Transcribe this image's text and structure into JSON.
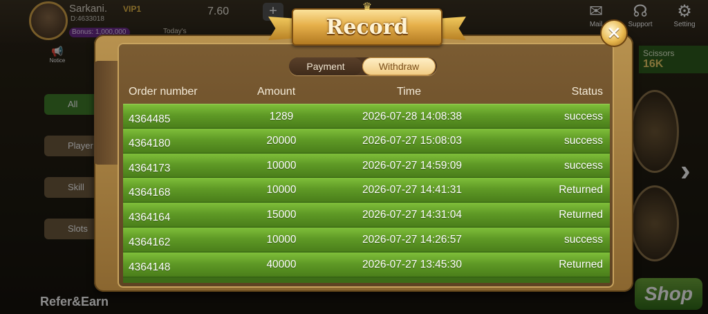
{
  "background": {
    "user_name": "Sarkani.",
    "user_id": "D:4633018",
    "bonus": "Bonus: 1,000,000",
    "vip": "VIP1",
    "balance": "7.60",
    "today_label": "Today's",
    "notice_label": "Notice",
    "top_icons": [
      {
        "name": "mail-icon",
        "label": "Mail",
        "glyph": "✉"
      },
      {
        "name": "support-icon",
        "label": "Support",
        "glyph": "☊"
      },
      {
        "name": "setting-icon",
        "label": "Setting",
        "glyph": "⚙"
      }
    ],
    "side_buttons": [
      "All",
      "Player",
      "Skill",
      "Slots"
    ],
    "right_game": {
      "label": "Scissors",
      "value": "16K"
    },
    "shop_label": "Shop",
    "refer_label": "Refer&Earn"
  },
  "modal": {
    "title": "Record",
    "close_glyph": "✕",
    "tabs": [
      {
        "label": "Payment",
        "active": false
      },
      {
        "label": "Withdraw",
        "active": true
      }
    ],
    "columns": {
      "order": "Order number",
      "amount": "Amount",
      "time": "Time",
      "status": "Status"
    },
    "rows": [
      {
        "order": "4364485",
        "amount": "1289",
        "time": "2026-07-28 14:08:38",
        "status": "success"
      },
      {
        "order": "4364180",
        "amount": "20000",
        "time": "2026-07-27 15:08:03",
        "status": "success"
      },
      {
        "order": "4364173",
        "amount": "10000",
        "time": "2026-07-27 14:59:09",
        "status": "success"
      },
      {
        "order": "4364168",
        "amount": "10000",
        "time": "2026-07-27 14:41:31",
        "status": "Returned"
      },
      {
        "order": "4364164",
        "amount": "15000",
        "time": "2026-07-27 14:31:04",
        "status": "Returned"
      },
      {
        "order": "4364162",
        "amount": "10000",
        "time": "2026-07-27 14:26:57",
        "status": "success"
      },
      {
        "order": "4364148",
        "amount": "40000",
        "time": "2026-07-27 13:45:30",
        "status": "Returned"
      }
    ]
  },
  "colors": {
    "row_green": "#5f9a26",
    "modal_brown": "#6b4e2a",
    "gold": "#e6b04a"
  }
}
